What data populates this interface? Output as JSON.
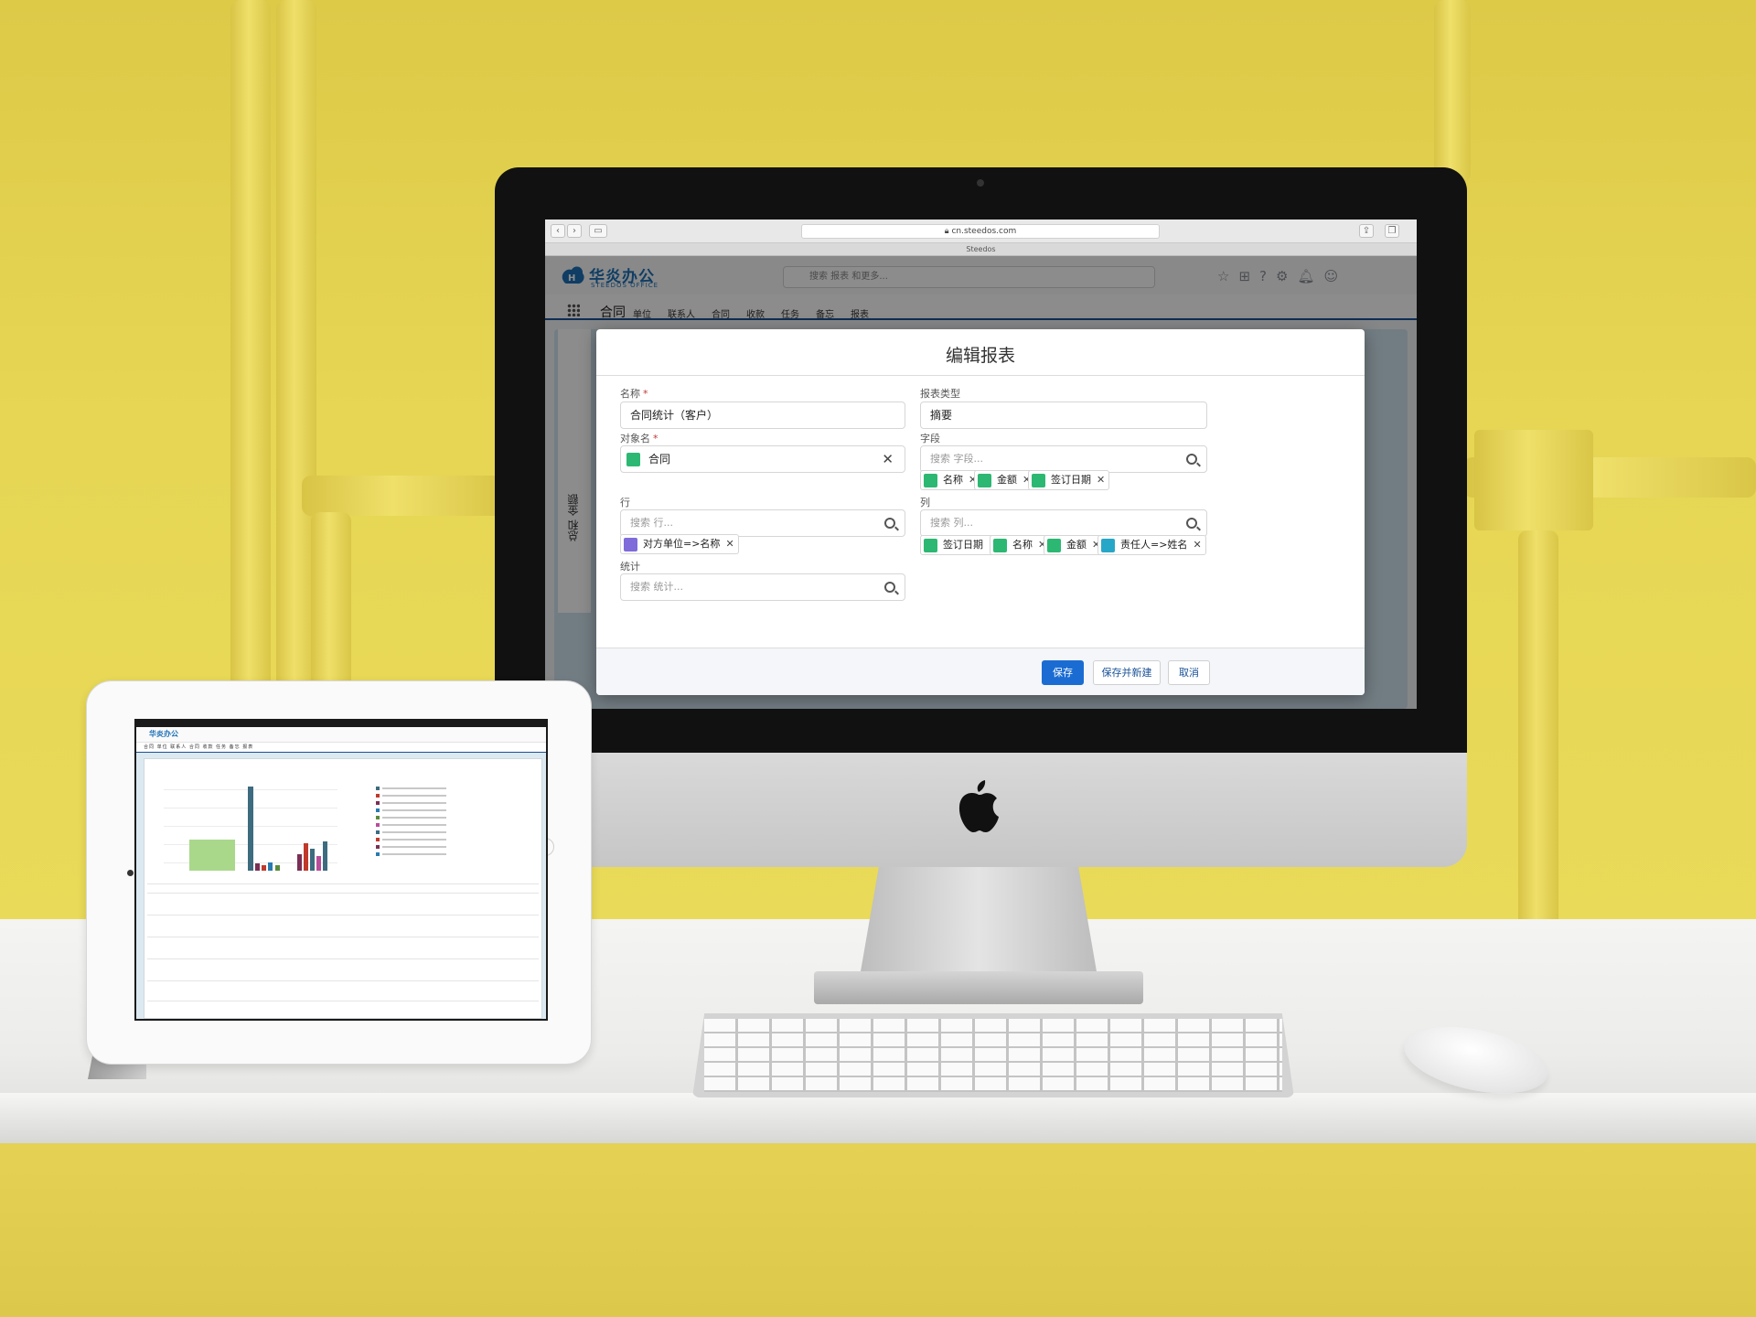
{
  "browser": {
    "url": "cn.steedos.com",
    "tab_title": "Steedos"
  },
  "app": {
    "logo_text": "华炎办公",
    "logo_subtext": "STEEDOS OFFICE",
    "search_placeholder": "搜索 报表 和更多...",
    "current_app": "合同",
    "nav": [
      "单位",
      "联系人",
      "合同",
      "收款",
      "任务",
      "备忘",
      "报表"
    ],
    "side_label": "总和 金额"
  },
  "modal": {
    "title": "编辑报表",
    "name_label": "名称",
    "name_value": "合同统计（客户）",
    "object_label": "对象名",
    "object_value": "合同",
    "report_type_label": "报表类型",
    "report_type_value": "摘要",
    "fields_label": "字段",
    "fields_placeholder": "搜索 字段...",
    "fields": [
      "名称",
      "金额",
      "签订日期"
    ],
    "rows_label": "行",
    "rows_placeholder": "搜索 行...",
    "rows": [
      "对方单位=>名称"
    ],
    "columns_label": "列",
    "columns_placeholder": "搜索 列...",
    "columns": [
      "签订日期",
      "名称",
      "金额",
      "责任人=>姓名"
    ],
    "stats_label": "统计",
    "stats_placeholder": "搜索 统计...",
    "save": "保存",
    "save_new": "保存并新建",
    "cancel": "取消"
  },
  "tablet": {
    "logo_text": "华炎办公",
    "current_app": "合同",
    "nav": [
      "单位",
      "联系人",
      "合同",
      "收款",
      "任务",
      "备忘",
      "报表"
    ]
  },
  "colors": {
    "brand_blue": "#1c6fb6",
    "primary_button": "#1b6cd2",
    "field_pill_green": "#2cb872",
    "lookup_pill_purple": "#7f6bd9",
    "user_pill_teal": "#27a7c7",
    "wall_yellow": "#e6d453"
  }
}
